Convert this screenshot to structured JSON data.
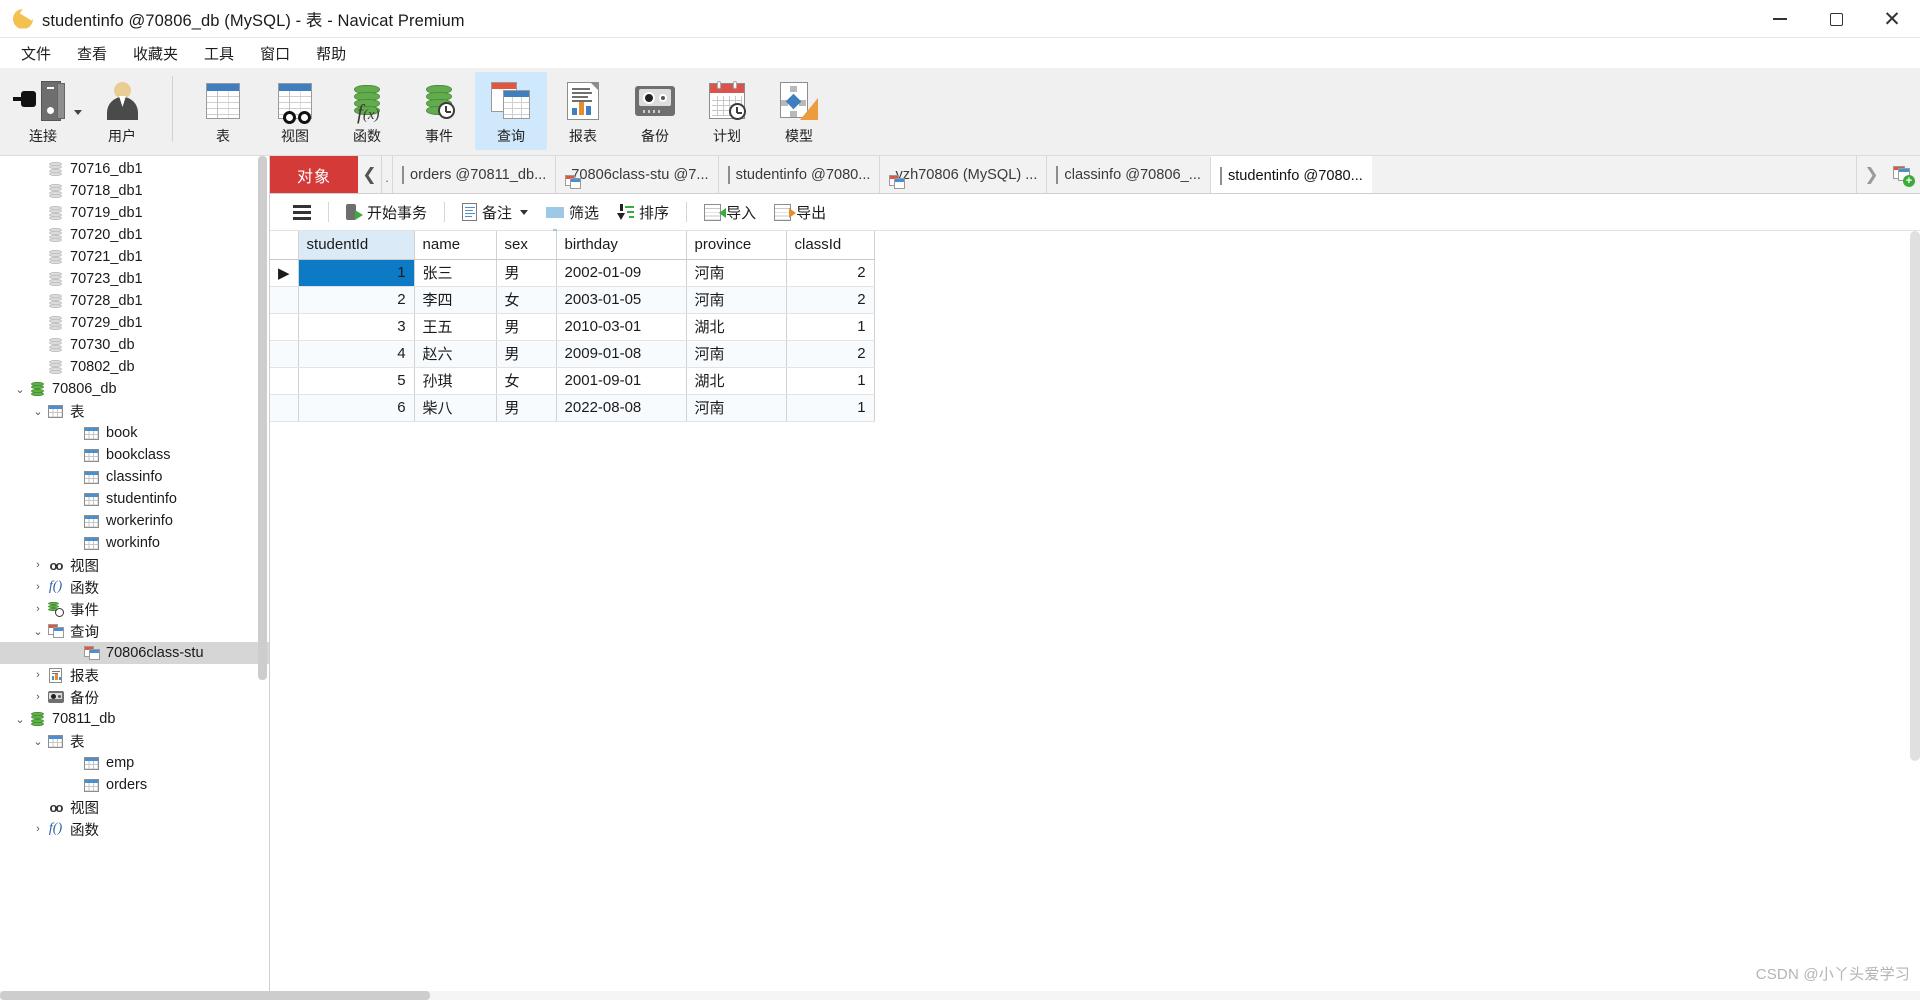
{
  "window": {
    "title": "studentinfo @70806_db (MySQL) - 表 - Navicat Premium",
    "logo_icon": "navicat-logo-icon",
    "minimize_icon": "minimize-icon",
    "maximize_icon": "maximize-icon",
    "close_icon": "close-icon"
  },
  "menubar": {
    "items": [
      {
        "label": "文件"
      },
      {
        "label": "查看"
      },
      {
        "label": "收藏夹"
      },
      {
        "label": "工具"
      },
      {
        "label": "窗口"
      },
      {
        "label": "帮助"
      }
    ]
  },
  "ribbon": {
    "items": [
      {
        "label": "连接",
        "icon": "connection-plug-icon",
        "has_dropdown": true,
        "active": false
      },
      {
        "label": "用户",
        "icon": "user-icon",
        "has_dropdown": false,
        "active": false
      },
      {
        "label": "表",
        "icon": "table-icon",
        "has_dropdown": false,
        "active": false
      },
      {
        "label": "视图",
        "icon": "view-glasses-icon",
        "has_dropdown": false,
        "active": false
      },
      {
        "label": "函数",
        "icon": "function-fx-icon",
        "has_dropdown": false,
        "active": false
      },
      {
        "label": "事件",
        "icon": "event-clock-icon",
        "has_dropdown": false,
        "active": false
      },
      {
        "label": "查询",
        "icon": "query-icon",
        "has_dropdown": false,
        "active": true
      },
      {
        "label": "报表",
        "icon": "report-icon",
        "has_dropdown": false,
        "active": false
      },
      {
        "label": "备份",
        "icon": "backup-icon",
        "has_dropdown": false,
        "active": false
      },
      {
        "label": "计划",
        "icon": "schedule-calendar-icon",
        "has_dropdown": false,
        "active": false
      },
      {
        "label": "模型",
        "icon": "model-icon",
        "has_dropdown": false,
        "active": false
      }
    ]
  },
  "sidebar": {
    "scroll_thumb_visible": true,
    "tree": [
      {
        "label": "70716_db1",
        "icon": "database-gray-icon",
        "indent": 2,
        "twist": "",
        "selected": false
      },
      {
        "label": "70718_db1",
        "icon": "database-gray-icon",
        "indent": 2,
        "twist": "",
        "selected": false
      },
      {
        "label": "70719_db1",
        "icon": "database-gray-icon",
        "indent": 2,
        "twist": "",
        "selected": false
      },
      {
        "label": "70720_db1",
        "icon": "database-gray-icon",
        "indent": 2,
        "twist": "",
        "selected": false
      },
      {
        "label": "70721_db1",
        "icon": "database-gray-icon",
        "indent": 2,
        "twist": "",
        "selected": false
      },
      {
        "label": "70723_db1",
        "icon": "database-gray-icon",
        "indent": 2,
        "twist": "",
        "selected": false
      },
      {
        "label": "70728_db1",
        "icon": "database-gray-icon",
        "indent": 2,
        "twist": "",
        "selected": false
      },
      {
        "label": "70729_db1",
        "icon": "database-gray-icon",
        "indent": 2,
        "twist": "",
        "selected": false
      },
      {
        "label": "70730_db",
        "icon": "database-gray-icon",
        "indent": 2,
        "twist": "",
        "selected": false
      },
      {
        "label": "70802_db",
        "icon": "database-gray-icon",
        "indent": 2,
        "twist": "",
        "selected": false
      },
      {
        "label": "70806_db",
        "icon": "database-green-icon",
        "indent": 1,
        "twist": "expanded",
        "selected": false
      },
      {
        "label": "表",
        "icon": "table-folder-icon",
        "indent": 2,
        "twist": "expanded",
        "selected": false
      },
      {
        "label": "book",
        "icon": "table-icon",
        "indent": 4,
        "twist": "",
        "selected": false
      },
      {
        "label": "bookclass",
        "icon": "table-icon",
        "indent": 4,
        "twist": "",
        "selected": false
      },
      {
        "label": "classinfo",
        "icon": "table-icon",
        "indent": 4,
        "twist": "",
        "selected": false
      },
      {
        "label": "studentinfo",
        "icon": "table-icon",
        "indent": 4,
        "twist": "",
        "selected": false
      },
      {
        "label": "workerinfo",
        "icon": "table-icon",
        "indent": 4,
        "twist": "",
        "selected": false
      },
      {
        "label": "workinfo",
        "icon": "table-icon",
        "indent": 4,
        "twist": "",
        "selected": false
      },
      {
        "label": "视图",
        "icon": "view-glasses-icon",
        "indent": 2,
        "twist": "collapsed",
        "selected": false
      },
      {
        "label": "函数",
        "icon": "function-fx-icon",
        "indent": 2,
        "twist": "collapsed",
        "selected": false
      },
      {
        "label": "事件",
        "icon": "event-clock-icon",
        "indent": 2,
        "twist": "collapsed",
        "selected": false
      },
      {
        "label": "查询",
        "icon": "query-icon",
        "indent": 2,
        "twist": "expanded",
        "selected": false
      },
      {
        "label": "70806class-stu",
        "icon": "query-icon",
        "indent": 4,
        "twist": "",
        "selected": true
      },
      {
        "label": "报表",
        "icon": "report-icon",
        "indent": 2,
        "twist": "collapsed",
        "selected": false
      },
      {
        "label": "备份",
        "icon": "backup-icon",
        "indent": 2,
        "twist": "collapsed",
        "selected": false
      },
      {
        "label": "70811_db",
        "icon": "database-green-icon",
        "indent": 1,
        "twist": "expanded",
        "selected": false
      },
      {
        "label": "表",
        "icon": "table-folder-icon",
        "indent": 2,
        "twist": "expanded",
        "selected": false
      },
      {
        "label": "emp",
        "icon": "table-icon",
        "indent": 4,
        "twist": "",
        "selected": false
      },
      {
        "label": "orders",
        "icon": "table-icon",
        "indent": 4,
        "twist": "",
        "selected": false
      },
      {
        "label": "视图",
        "icon": "view-glasses-icon",
        "indent": 2,
        "twist": "",
        "selected": false
      },
      {
        "label": "函数",
        "icon": "function-fx-icon",
        "indent": 2,
        "twist": "collapsed",
        "selected": false
      }
    ]
  },
  "tabstrip": {
    "object_button": "对象",
    "back_icon": "chevron-left-icon",
    "more_icon": "chevron-double-right-icon",
    "add_icon": "new-query-icon",
    "tabs": [
      {
        "label": "orders @70811_db...",
        "icon": "table-icon",
        "active": false
      },
      {
        "label": "70806class-stu @7...",
        "icon": "query-icon",
        "active": false
      },
      {
        "label": "studentinfo @7080...",
        "icon": "table-icon",
        "active": false
      },
      {
        "label": "yzh70806 (MySQL) ...",
        "icon": "query-icon",
        "active": false
      },
      {
        "label": "classinfo @70806_...",
        "icon": "table-icon",
        "active": false
      },
      {
        "label": "studentinfo @7080...",
        "icon": "table-icon",
        "active": true
      }
    ]
  },
  "gridbar": {
    "menu_icon": "hamburger-icon",
    "items": [
      {
        "label": "开始事务",
        "icon": "begin-transaction-icon",
        "dropdown": false
      },
      {
        "label": "备注",
        "icon": "note-icon",
        "dropdown": true
      },
      {
        "label": "筛选",
        "icon": "filter-funnel-icon",
        "dropdown": false
      },
      {
        "label": "排序",
        "icon": "sort-icon",
        "dropdown": false
      },
      {
        "label": "导入",
        "icon": "import-icon",
        "dropdown": false
      },
      {
        "label": "导出",
        "icon": "export-icon",
        "dropdown": false
      }
    ]
  },
  "datagrid": {
    "columns": [
      "studentId",
      "name",
      "sex",
      "birthday",
      "province",
      "classId"
    ],
    "selected_cell": {
      "row": 0,
      "column": "studentId"
    },
    "rows": [
      {
        "studentId": "1",
        "name": "张三",
        "sex": "男",
        "birthday": "2002-01-09",
        "province": "河南",
        "classId": "2"
      },
      {
        "studentId": "2",
        "name": "李四",
        "sex": "女",
        "birthday": "2003-01-05",
        "province": "河南",
        "classId": "2"
      },
      {
        "studentId": "3",
        "name": "王五",
        "sex": "男",
        "birthday": "2010-03-01",
        "province": "湖北",
        "classId": "1"
      },
      {
        "studentId": "4",
        "name": "赵六",
        "sex": "男",
        "birthday": "2009-01-08",
        "province": "河南",
        "classId": "2"
      },
      {
        "studentId": "5",
        "name": "孙琪",
        "sex": "女",
        "birthday": "2001-09-01",
        "province": "湖北",
        "classId": "1"
      },
      {
        "studentId": "6",
        "name": "柴八",
        "sex": "男",
        "birthday": "2022-08-08",
        "province": "河南",
        "classId": "1"
      }
    ]
  },
  "watermark": {
    "text": "CSDN @小丫头爱学习"
  },
  "colors": {
    "accent_red": "#d33a38",
    "accent_blue": "#0d7ac6",
    "ribbon_active": "#cfe8fb",
    "header_pk": "#dbeaf7"
  }
}
